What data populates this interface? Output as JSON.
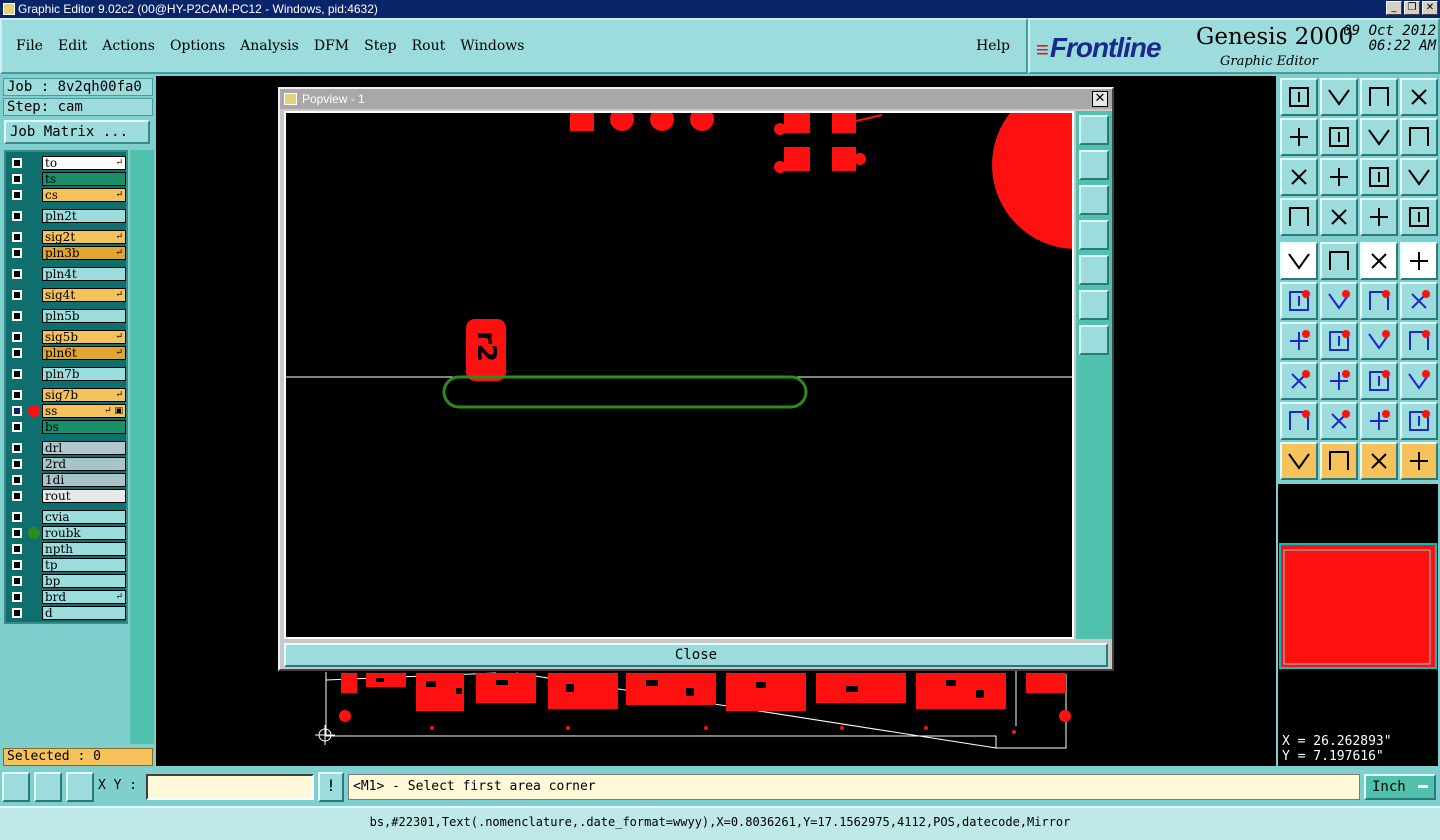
{
  "window": {
    "title": "Graphic Editor 9.02c2 (00@HY-P2CAM-PC12 - Windows, pid:4632)"
  },
  "menu": {
    "items": [
      "File",
      "Edit",
      "Actions",
      "Options",
      "Analysis",
      "DFM",
      "Step",
      "Rout",
      "Windows"
    ],
    "help": "Help"
  },
  "brand": {
    "logo": "Frontline",
    "product": "Genesis 2000",
    "subtitle": "Graphic Editor",
    "date": "09 Oct 2012",
    "time": "06:22 AM"
  },
  "job": {
    "job_label": "Job : 8v2qh00fa0",
    "step_label": "Step: cam",
    "matrix_button": "Job Matrix ..."
  },
  "layers": [
    {
      "name": "to",
      "color": "#ffffff",
      "mark": "↵"
    },
    {
      "name": "ts",
      "color": "#1a8f6a",
      "mark": ""
    },
    {
      "name": "cs",
      "color": "#f6c25c",
      "mark": "↵"
    },
    {
      "name": "pln2t",
      "color": "#9ddcdc",
      "mark": ""
    },
    {
      "name": "sig2t",
      "color": "#f6c25c",
      "mark": "↵"
    },
    {
      "name": "pln3b",
      "color": "#e0a630",
      "mark": "↵"
    },
    {
      "name": "pln4t",
      "color": "#9ddcdc",
      "mark": ""
    },
    {
      "name": "sig4t",
      "color": "#f6c25c",
      "mark": "↵"
    },
    {
      "name": "pln5b",
      "color": "#9ddcdc",
      "mark": ""
    },
    {
      "name": "sig5b",
      "color": "#f6c25c",
      "mark": "↵"
    },
    {
      "name": "pln6t",
      "color": "#e0a630",
      "mark": "↵"
    },
    {
      "name": "pln7b",
      "color": "#9ddcdc",
      "mark": ""
    },
    {
      "name": "sig7b",
      "color": "#f6c25c",
      "mark": "↵"
    },
    {
      "name": "ss",
      "color": "#f6c25c",
      "mark": "↵ ▣"
    },
    {
      "name": "bs",
      "color": "#1a8f6a",
      "mark": ""
    },
    {
      "name": "drl",
      "color": "#b0c8cc",
      "mark": ""
    },
    {
      "name": "2rd",
      "color": "#a8c4c8",
      "mark": ""
    },
    {
      "name": "1di",
      "color": "#a8c4c8",
      "mark": ""
    },
    {
      "name": "rout",
      "color": "#e8e8e8",
      "mark": ""
    },
    {
      "name": "cvia",
      "color": "#9ddcdc",
      "mark": ""
    },
    {
      "name": "roubk",
      "color": "#9ddcdc",
      "mark": ""
    },
    {
      "name": "npth",
      "color": "#9ddcdc",
      "mark": ""
    },
    {
      "name": "tp",
      "color": "#9ddcdc",
      "mark": ""
    },
    {
      "name": "bp",
      "color": "#9ddcdc",
      "mark": ""
    },
    {
      "name": "brd",
      "color": "#9ddcdc",
      "mark": "↵"
    },
    {
      "name": "d",
      "color": "#9ddcdc",
      "mark": ""
    }
  ],
  "selected": "Selected : 0",
  "popview": {
    "title": "Popview - 1",
    "close_button": "Close",
    "text_mark": "r2"
  },
  "coords": {
    "x": "X = 26.262893\"",
    "y": "Y = 7.197616\""
  },
  "command": {
    "xy_label": "X Y :",
    "xy_value": "",
    "prompt": "<M1> - Select first area corner",
    "units": "Inch"
  },
  "status": "bs,#22301,Text(.nomenclature,.date_format=wwyy),X=0.8036261,Y=17.1562975,4112,POS,datecode,Mirror"
}
